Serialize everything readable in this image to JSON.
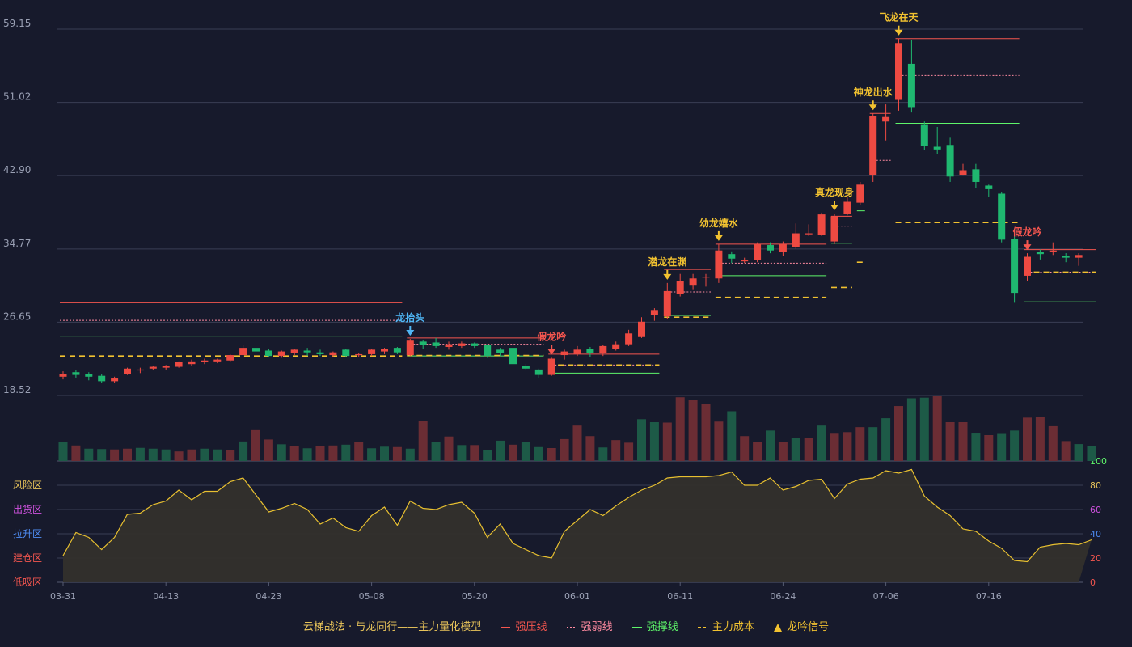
{
  "chart_data": {
    "type": "candlestick",
    "price_axis": {
      "ticks": [
        59.15,
        51.02,
        42.9,
        34.77,
        26.65,
        18.52
      ],
      "ylim": [
        18.52,
        59.15
      ]
    },
    "x_ticks": [
      {
        "i": 0,
        "label": "03-31"
      },
      {
        "i": 8,
        "label": "04-13"
      },
      {
        "i": 16,
        "label": "04-23"
      },
      {
        "i": 24,
        "label": "05-08"
      },
      {
        "i": 32,
        "label": "05-20"
      },
      {
        "i": 40,
        "label": "06-01"
      },
      {
        "i": 48,
        "label": "06-11"
      },
      {
        "i": 56,
        "label": "06-24"
      },
      {
        "i": 64,
        "label": "07-06"
      },
      {
        "i": 72,
        "label": "07-16"
      }
    ],
    "candles": [
      [
        20.6,
        20.9,
        20.3,
        21.2
      ],
      [
        21.1,
        20.8,
        20.5,
        21.3
      ],
      [
        20.9,
        20.6,
        20.2,
        21.1
      ],
      [
        20.7,
        20.1,
        19.9,
        20.9
      ],
      [
        20.1,
        20.4,
        19.9,
        20.6
      ],
      [
        20.9,
        21.5,
        20.8,
        21.6
      ],
      [
        21.3,
        21.4,
        21.0,
        21.6
      ],
      [
        21.5,
        21.7,
        21.3,
        21.8
      ],
      [
        21.6,
        21.8,
        21.4,
        21.9
      ],
      [
        21.7,
        22.2,
        21.6,
        22.3
      ],
      [
        22.0,
        22.3,
        21.8,
        22.5
      ],
      [
        22.2,
        22.4,
        22.0,
        22.6
      ],
      [
        22.3,
        22.5,
        22.1,
        22.6
      ],
      [
        22.4,
        23.0,
        22.2,
        23.1
      ],
      [
        23.0,
        23.8,
        22.8,
        24.1
      ],
      [
        23.8,
        23.4,
        23.2,
        24.0
      ],
      [
        23.5,
        22.9,
        22.8,
        23.7
      ],
      [
        22.9,
        23.4,
        22.7,
        23.5
      ],
      [
        23.2,
        23.6,
        23.0,
        23.7
      ],
      [
        23.5,
        23.3,
        22.9,
        23.8
      ],
      [
        23.3,
        23.1,
        22.9,
        23.6
      ],
      [
        23.0,
        23.3,
        22.8,
        23.4
      ],
      [
        23.6,
        22.9,
        22.8,
        23.7
      ],
      [
        23.0,
        23.1,
        22.8,
        23.2
      ],
      [
        23.1,
        23.6,
        22.9,
        23.7
      ],
      [
        23.4,
        23.7,
        23.1,
        23.8
      ],
      [
        23.8,
        23.3,
        23.1,
        23.9
      ],
      [
        23.0,
        24.6,
        22.9,
        24.8
      ],
      [
        24.5,
        24.1,
        23.7,
        24.7
      ],
      [
        24.4,
        24.0,
        23.8,
        24.9
      ],
      [
        23.9,
        24.2,
        23.6,
        24.5
      ],
      [
        24.0,
        24.3,
        23.8,
        24.5
      ],
      [
        24.3,
        24.0,
        23.8,
        24.4
      ],
      [
        24.1,
        22.9,
        22.7,
        24.2
      ],
      [
        23.6,
        23.2,
        22.9,
        23.8
      ],
      [
        23.8,
        22.0,
        21.9,
        23.9
      ],
      [
        21.8,
        21.5,
        21.3,
        22.0
      ],
      [
        21.4,
        20.8,
        20.5,
        21.5
      ],
      [
        20.8,
        22.6,
        20.7,
        22.7
      ],
      [
        23.0,
        23.4,
        22.5,
        23.6
      ],
      [
        23.1,
        23.6,
        22.9,
        24.0
      ],
      [
        23.7,
        23.2,
        22.8,
        23.9
      ],
      [
        23.2,
        24.0,
        22.9,
        24.1
      ],
      [
        23.7,
        24.2,
        23.5,
        24.5
      ],
      [
        24.2,
        25.4,
        24.0,
        25.8
      ],
      [
        25.0,
        26.7,
        24.9,
        27.2
      ],
      [
        27.4,
        28.0,
        26.8,
        28.2
      ],
      [
        27.3,
        30.1,
        27.0,
        31.0
      ],
      [
        29.8,
        31.2,
        29.5,
        32.0
      ],
      [
        30.7,
        31.5,
        30.3,
        32.0
      ],
      [
        31.6,
        31.7,
        30.6,
        32.0
      ],
      [
        31.5,
        34.6,
        31.0,
        35.3
      ],
      [
        34.2,
        33.7,
        33.2,
        34.5
      ],
      [
        33.4,
        33.5,
        33.2,
        33.8
      ],
      [
        33.5,
        35.3,
        33.3,
        35.5
      ],
      [
        35.2,
        34.6,
        34.3,
        35.5
      ],
      [
        34.4,
        35.3,
        34.0,
        35.6
      ],
      [
        35.0,
        36.5,
        34.8,
        37.6
      ],
      [
        36.4,
        36.5,
        36.2,
        37.5
      ],
      [
        36.3,
        38.6,
        36.2,
        38.8
      ],
      [
        35.6,
        38.4,
        35.3,
        38.7
      ],
      [
        38.7,
        40.0,
        38.5,
        40.5
      ],
      [
        39.9,
        41.9,
        39.6,
        42.2
      ],
      [
        43.0,
        49.5,
        42.2,
        49.8
      ],
      [
        48.9,
        49.4,
        46.8,
        50.8
      ],
      [
        51.3,
        57.6,
        50.1,
        58.1
      ],
      [
        55.3,
        50.5,
        49.9,
        57.9
      ],
      [
        48.6,
        46.2,
        45.7,
        48.9
      ],
      [
        46.1,
        45.8,
        45.3,
        48.3
      ],
      [
        46.3,
        42.8,
        42.2,
        47.1
      ],
      [
        43.0,
        43.5,
        42.9,
        44.2
      ],
      [
        43.6,
        42.2,
        41.5,
        44.2
      ],
      [
        41.8,
        41.4,
        40.5,
        41.9
      ],
      [
        40.9,
        35.8,
        35.5,
        41.1
      ],
      [
        35.9,
        29.9,
        28.8,
        36.2
      ],
      [
        31.8,
        33.9,
        31.2,
        34.3
      ],
      [
        34.4,
        34.2,
        33.6,
        34.7
      ],
      [
        34.4,
        34.6,
        34.1,
        35.5
      ],
      [
        34.0,
        33.8,
        33.3,
        34.3
      ],
      [
        33.8,
        34.1,
        32.9,
        34.3
      ]
    ],
    "volume": [
      95,
      78,
      62,
      60,
      58,
      62,
      66,
      62,
      58,
      48,
      58,
      62,
      58,
      55,
      98,
      155,
      108,
      84,
      74,
      64,
      74,
      78,
      82,
      95,
      64,
      72,
      70,
      62,
      200,
      94,
      123,
      80,
      80,
      53,
      102,
      82,
      95,
      70,
      65,
      110,
      178,
      125,
      68,
      105,
      92,
      210,
      195,
      193,
      320,
      305,
      285,
      198,
      250,
      125,
      95,
      153,
      95,
      116,
      115,
      178,
      137,
      145,
      170,
      170,
      215,
      276,
      315,
      318,
      325,
      195,
      195,
      138,
      130,
      136,
      153,
      218,
      222,
      175,
      100,
      85,
      77
    ],
    "volume_color": [
      "up",
      "down",
      "up",
      "up",
      "down",
      "down",
      "up",
      "up",
      "up",
      "down",
      "down",
      "up",
      "up",
      "down",
      "up",
      "down",
      "down",
      "up",
      "down",
      "up",
      "down",
      "down",
      "up",
      "down",
      "up",
      "up",
      "down",
      "up",
      "down",
      "up",
      "down",
      "up",
      "down",
      "up",
      "up",
      "down",
      "up",
      "up",
      "down",
      "down",
      "down",
      "down",
      "up",
      "down",
      "down",
      "up",
      "up",
      "down",
      "down",
      "down",
      "down",
      "down",
      "up",
      "down",
      "down",
      "up",
      "down",
      "up",
      "down",
      "up",
      "down",
      "down",
      "down",
      "up",
      "up",
      "down",
      "up",
      "up",
      "down",
      "down",
      "down",
      "up",
      "down",
      "up",
      "up",
      "down",
      "down",
      "down",
      "down",
      "up",
      "up"
    ],
    "indicator": [
      22,
      41,
      37,
      27,
      37,
      56,
      57,
      64,
      67,
      76,
      68,
      75,
      75,
      83,
      86,
      72,
      58,
      61,
      65,
      60,
      48,
      53,
      45,
      42,
      55,
      62,
      47,
      67,
      61,
      60,
      64,
      66,
      57,
      37,
      48,
      32,
      27,
      22,
      20,
      42,
      51,
      60,
      55,
      63,
      70,
      76,
      80,
      86,
      87,
      87,
      87,
      88,
      91,
      80,
      80,
      86,
      76,
      79,
      84,
      85,
      69,
      81,
      85,
      86,
      92,
      90,
      93,
      71,
      62,
      55,
      44,
      42,
      34,
      28,
      18,
      17,
      29,
      31,
      32,
      31,
      35
    ],
    "indicator_axis": {
      "ticks": [
        100,
        80,
        60,
        40,
        20,
        0
      ],
      "ylim": [
        0,
        100
      ]
    },
    "zones": [
      {
        "label": "风险区",
        "color": "#e8c45a",
        "level": 80
      },
      {
        "label": "出货区",
        "color": "#d052e0",
        "level": 60
      },
      {
        "label": "拉升区",
        "color": "#4f8ef5",
        "level": 40
      },
      {
        "label": "建仓区",
        "color": "#f5564f",
        "level": 20
      },
      {
        "label": "低吸区",
        "color": "#f5564f",
        "level": 0
      }
    ],
    "signals": [
      {
        "i": 27,
        "label": "龙抬头",
        "color": "#4fb6f5",
        "pos": "above",
        "price": 24.8
      },
      {
        "i": 38,
        "label": "假龙吟",
        "color": "#f5564f",
        "pos": "above",
        "price": 22.7
      },
      {
        "i": 47,
        "label": "潜龙在渊",
        "color": "#f2c230",
        "pos": "above",
        "price": 31.0
      },
      {
        "i": 51,
        "label": "幼龙嬉水",
        "color": "#f2c230",
        "pos": "above",
        "price": 35.3
      },
      {
        "i": 60,
        "label": "真龙现身",
        "color": "#f2c230",
        "pos": "above",
        "price": 38.7
      },
      {
        "i": 63,
        "label": "神龙出水",
        "color": "#f2c230",
        "pos": "above",
        "price": 49.8
      },
      {
        "i": 65,
        "label": "飞龙在天",
        "color": "#f2c230",
        "pos": "above",
        "price": 58.1
      },
      {
        "i": 75,
        "label": "假龙吟",
        "color": "#f5564f",
        "pos": "above",
        "price": 34.3
      }
    ],
    "levels": [
      {
        "from": 0,
        "to": 26,
        "pressure": 28.8,
        "weak": 26.85,
        "support": 25.1,
        "cost": 22.9
      },
      {
        "from": 27,
        "to": 37,
        "pressure": 24.9,
        "weak": 24.2,
        "support": 22.9,
        "cost": 22.95
      },
      {
        "from": 38,
        "to": 46,
        "pressure": 23.1,
        "weak": 21.9,
        "support": 21.0,
        "cost": 21.9
      },
      {
        "from": 47,
        "to": 50,
        "pressure": 32.5,
        "weak": 30.0,
        "support": 27.4,
        "cost": 27.2
      },
      {
        "from": 51,
        "to": 59,
        "pressure": 35.3,
        "weak": 33.2,
        "support": 31.8,
        "cost": 29.4
      },
      {
        "from": 60,
        "to": 61,
        "pressure": 38.4,
        "weak": 37.3,
        "support": 35.4,
        "cost": 30.5
      },
      {
        "from": 62,
        "to": 62,
        "pressure": null,
        "weak": null,
        "support": 39.0,
        "cost": 33.3
      },
      {
        "from": 63,
        "to": 64,
        "pressure": 49.8,
        "weak": 44.6,
        "support": null,
        "cost": null
      },
      {
        "from": 65,
        "to": 74,
        "pressure": 58.1,
        "weak": 54.0,
        "support": 48.7,
        "cost": 37.7
      },
      {
        "from": 75,
        "to": 80,
        "pressure": 34.7,
        "weak": 32.2,
        "support": 28.9,
        "cost": 32.2
      }
    ],
    "colors": {
      "up": "#ee4a42",
      "down": "#1fb870",
      "vol_up": "#6b2d34",
      "vol_down": "#1d5a47",
      "pressure": "#f5564f",
      "weak": "#ff8aa0",
      "support": "#5ef56a",
      "cost": "#f2c230",
      "indicator": "#e8c030",
      "grid": "#3a3e54",
      "axis_text": "#9aa0b4"
    }
  },
  "legend": {
    "title": "云梯战法 · 与龙同行——主力量化模型",
    "pressure": "强压线",
    "weak": "强弱线",
    "support": "强撑线",
    "cost": "主力成本",
    "signal": "龙吟信号"
  }
}
